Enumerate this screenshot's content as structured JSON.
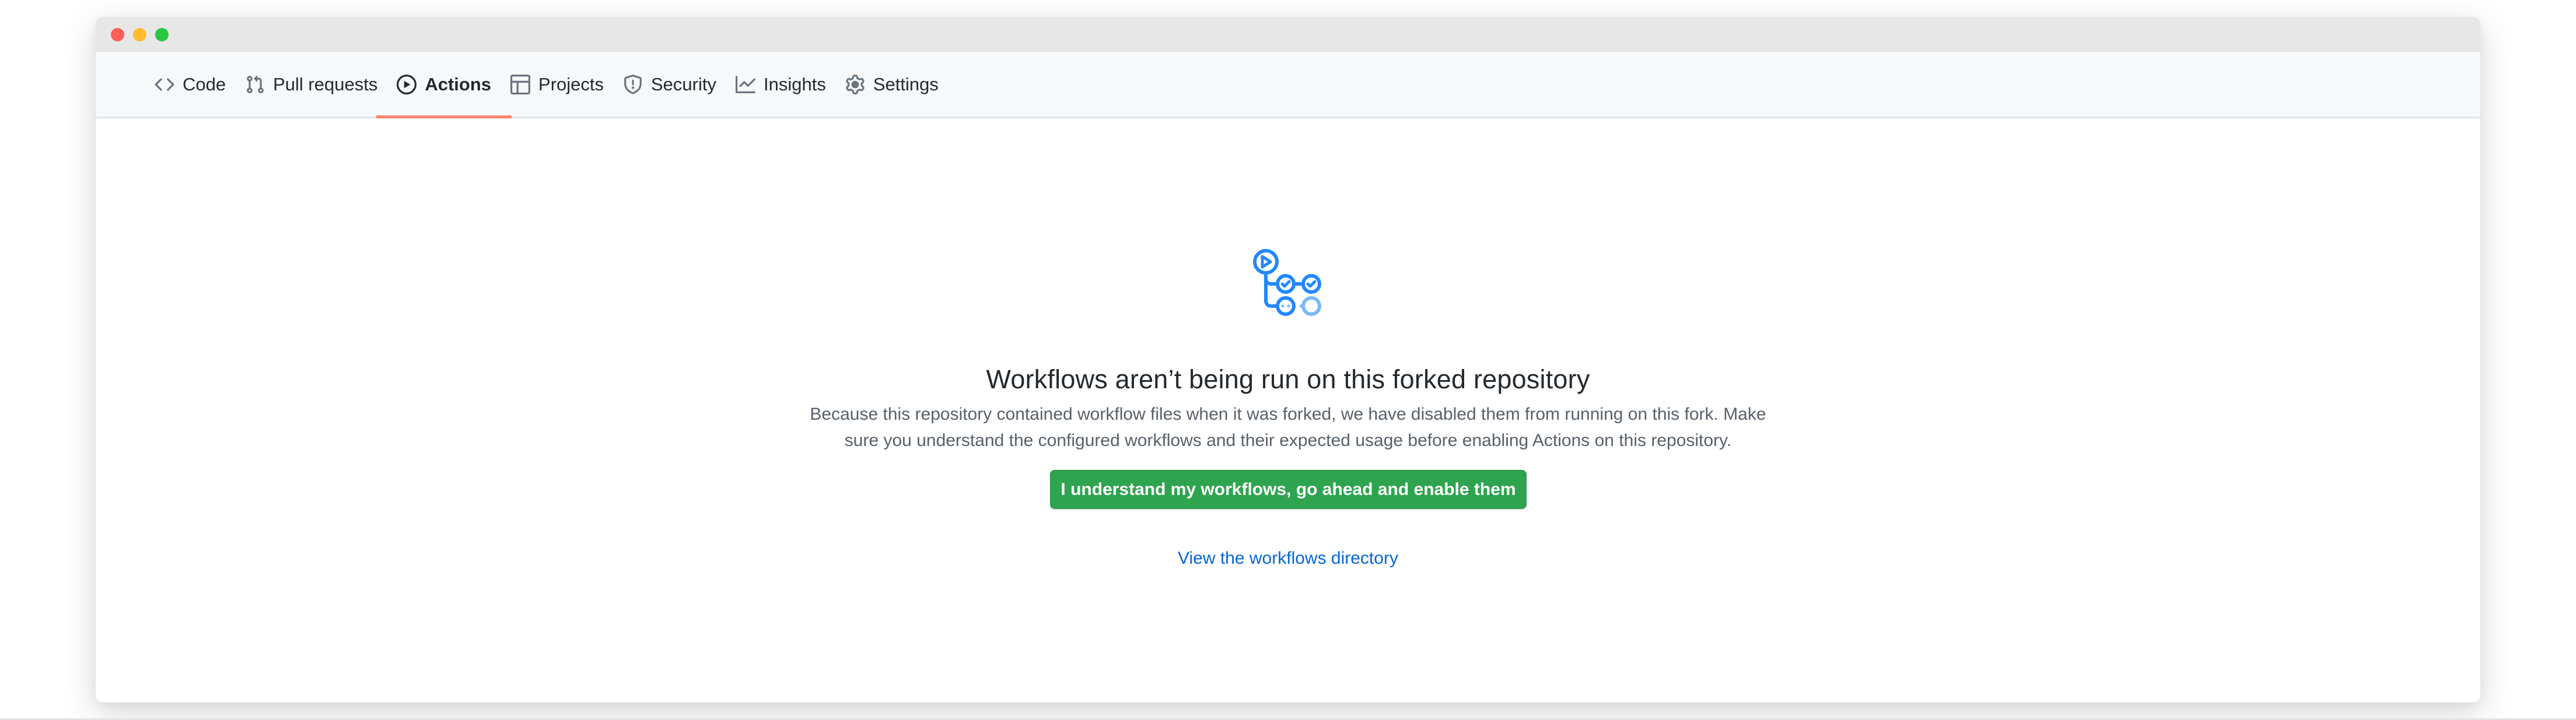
{
  "window": {
    "traffic_lights": [
      "close",
      "minimize",
      "zoom"
    ]
  },
  "nav": {
    "tabs": [
      {
        "label": "Code",
        "icon": "code-icon",
        "active": false
      },
      {
        "label": "Pull requests",
        "icon": "git-pull-request-icon",
        "active": false
      },
      {
        "label": "Actions",
        "icon": "play-icon",
        "active": true
      },
      {
        "label": "Projects",
        "icon": "project-icon",
        "active": false
      },
      {
        "label": "Security",
        "icon": "shield-icon",
        "active": false
      },
      {
        "label": "Insights",
        "icon": "graph-icon",
        "active": false
      },
      {
        "label": "Settings",
        "icon": "gear-icon",
        "active": false
      }
    ]
  },
  "main": {
    "icon": "workflow-icon",
    "title": "Workflows aren’t being run on this forked repository",
    "description": "Because this repository contained workflow files when it was forked, we have disabled them from running on this fork. Make sure you understand the configured workflows and their expected usage before enabling Actions on this repository.",
    "enable_button_label": "I understand my workflows, go ahead and enable them",
    "link_label": "View the workflows directory"
  },
  "colors": {
    "active_tab_underline": "#f9826c",
    "primary_button": "#2ea44f",
    "link": "#0366d6",
    "workflow_icon": "#2188ff",
    "workflow_icon_light": "#79b8ff"
  }
}
